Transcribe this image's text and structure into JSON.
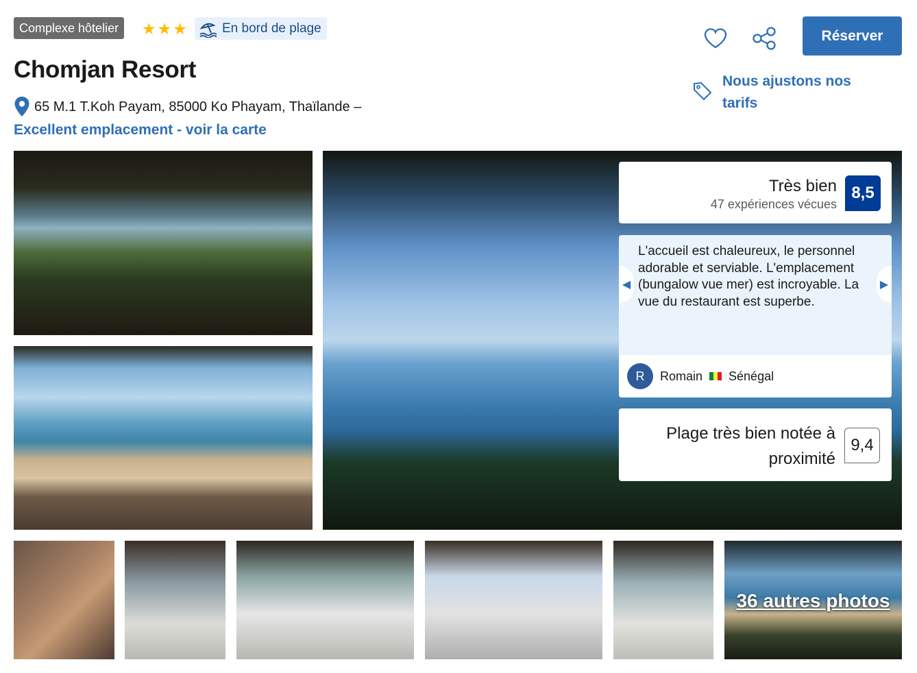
{
  "header": {
    "property_type": "Complexe hôtelier",
    "star_count": 3,
    "star_color": "#febb02",
    "beach_badge": "En bord de plage",
    "beach_badge_icon": "beach-umbrella-icon",
    "hotel_name": "Chomjan Resort",
    "address": "65 M.1 T.Koh Payam, 85000 Ko Phayam, Thaïlande –",
    "location_link": "Excellent emplacement - voir la carte"
  },
  "actions": {
    "favorite_icon": "heart-icon",
    "share_icon": "share-icon",
    "reserve_label": "Réserver",
    "price_note": "Nous ajustons nos tarifs",
    "price_note_icon": "tag-icon"
  },
  "review_summary": {
    "label": "Très bien",
    "count_text": "47 expériences vécues",
    "score": "8,5"
  },
  "featured_review": {
    "text": "L'accueil est chaleureux, le personnel adorable et serviable. L'emplacement (bungalow vue mer) est incroyable. La vue du restaurant est superbe.",
    "reviewer_initial": "R",
    "reviewer_name": "Romain",
    "reviewer_country": "Sénégal"
  },
  "beach_rating": {
    "label": "Plage très bien notée à proximité",
    "score": "9,4"
  },
  "gallery": {
    "more_photos": "36 autres photos"
  },
  "colors": {
    "brand_blue": "#2f6fb5",
    "score_navy": "#003b95"
  }
}
